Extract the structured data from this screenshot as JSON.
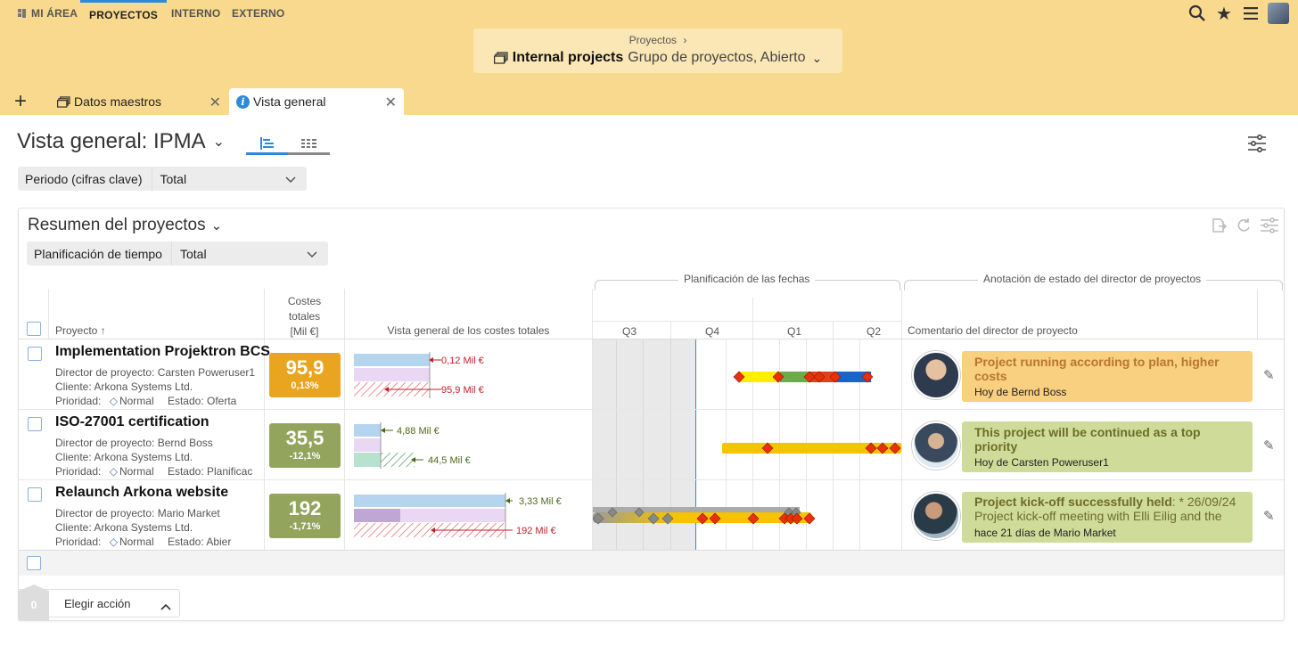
{
  "nav": {
    "items": [
      {
        "label": "MI ÁREA"
      },
      {
        "label": "PROYECTOS"
      },
      {
        "label": "INTERNO"
      },
      {
        "label": "EXTERNO"
      }
    ]
  },
  "breadcrumb": {
    "parent": "Proyectos",
    "title": "Internal projects",
    "subtitle": "Grupo de proyectos, Abierto"
  },
  "tabs": [
    {
      "label": "Datos maestros"
    },
    {
      "label": "Vista general"
    }
  ],
  "page": {
    "title": "Vista general: IPMA",
    "period_label": "Periodo (cifras clave)",
    "period_value": "Total"
  },
  "card": {
    "title": "Resumen del proyectos",
    "plan_label": "Planificación de tiempo",
    "plan_value": "Total",
    "headers": {
      "project": "Proyecto ↑",
      "costs_line1": "Costes",
      "costs_line2": "totales",
      "costs_line3": "[Mil €]",
      "overview": "Vista general de los costes totales",
      "planning_group": "Planificación de las fechas",
      "status_group": "Anotación de estado del director de proyectos",
      "comment": "Comentario del director de proyecto",
      "quarters": [
        "Q3",
        "Q4",
        "Q1",
        "Q2"
      ]
    }
  },
  "projects": [
    {
      "name": "Implementation Projektron BCS",
      "director": "Director de proyecto:  Carsten Poweruser1",
      "client": "Cliente:  Arkona Systems Ltd.",
      "priority_label": "Prioridad:",
      "priority": "Normal",
      "status": "Estado:  Oferta",
      "kpi_value": "95,9",
      "kpi_pct": "0,13%",
      "kpi_color": "#e9a51f",
      "bar_label_top": "0,12 Mil €",
      "bar_label_bottom": "95,9 Mil €",
      "note_title": "Project running according to plan, higher costs",
      "note_sub": "",
      "note_footer": "Hoy de Bernd Boss",
      "note_color": "#f9cf80"
    },
    {
      "name": "ISO-27001 certification",
      "director": "Director de proyecto:  Bernd Boss",
      "client": "Cliente:  Arkona Systems Ltd.",
      "priority_label": "Prioridad:",
      "priority": "Normal",
      "status": "Estado:  Planificac",
      "kpi_value": "35,5",
      "kpi_pct": "-12,1%",
      "kpi_color": "#93a55c",
      "bar_label_top": "4,88 Mil €",
      "bar_label_bottom": "44,5 Mil €",
      "note_title": "This project will be continued as a top priority",
      "note_sub": "",
      "note_footer": "Hoy de Carsten Poweruser1",
      "note_color": "#cfdb98"
    },
    {
      "name": "Relaunch Arkona website",
      "director": "Director de proyecto:  Mario Market",
      "client": "Cliente:  Arkona Systems Ltd.",
      "priority_label": "Prioridad:",
      "priority": "Normal",
      "status": "Estado:  Abier",
      "kpi_value": "192",
      "kpi_pct": "-1,71%",
      "kpi_color": "#93a55c",
      "bar_label_top": "3,33 Mil €",
      "bar_label_bottom": "192 Mil €",
      "note_title": "Project kick-off successfully held",
      "note_title_suffix": ": * 26/09/24",
      "note_sub": "Project kick-off meeting with Elli Eilig and the",
      "note_footer": "hace 21 días de Mario Market",
      "note_color": "#cfdb98"
    }
  ],
  "action": {
    "count": "0",
    "label": "Elegir acción"
  },
  "colors": {
    "topbar": "#f9d98d",
    "accent": "#2d8ad8"
  }
}
